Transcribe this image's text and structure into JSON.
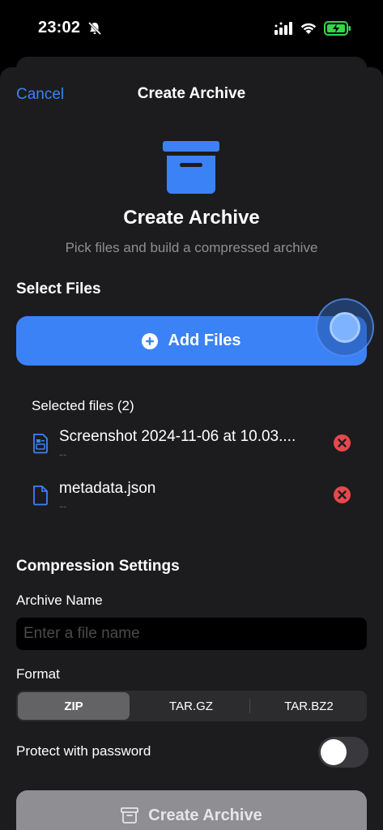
{
  "status_bar": {
    "time": "23:02",
    "icons": [
      "bell-slash-icon",
      "cellular-signal-icon",
      "wifi-icon",
      "battery-charging-icon"
    ]
  },
  "nav": {
    "cancel_label": "Cancel",
    "title": "Create Archive"
  },
  "hero": {
    "icon": "archivebox-icon",
    "title": "Create Archive",
    "subtitle": "Pick files and build a compressed archive"
  },
  "select_files": {
    "section_title": "Select Files",
    "add_button_label": "Add Files",
    "selected_header": "Selected files (2)",
    "files": [
      {
        "name": "Screenshot 2024-11-06 at 10.03....",
        "size": "--",
        "icon": "image-document-icon"
      },
      {
        "name": "metadata.json",
        "size": "--",
        "icon": "document-icon"
      }
    ]
  },
  "compression": {
    "section_title": "Compression Settings",
    "archive_name_label": "Archive Name",
    "archive_name_value": "",
    "archive_name_placeholder": "Enter a file name",
    "format_label": "Format",
    "formats": [
      "ZIP",
      "TAR.GZ",
      "TAR.BZ2"
    ],
    "selected_format": "ZIP",
    "password_label": "Protect with password",
    "password_enabled": false
  },
  "create_button_label": "Create Archive",
  "colors": {
    "accent": "#3b82f6",
    "background": "#1c1c1e",
    "remove": "#e5484d",
    "disabled_button": "#8e8e93"
  }
}
